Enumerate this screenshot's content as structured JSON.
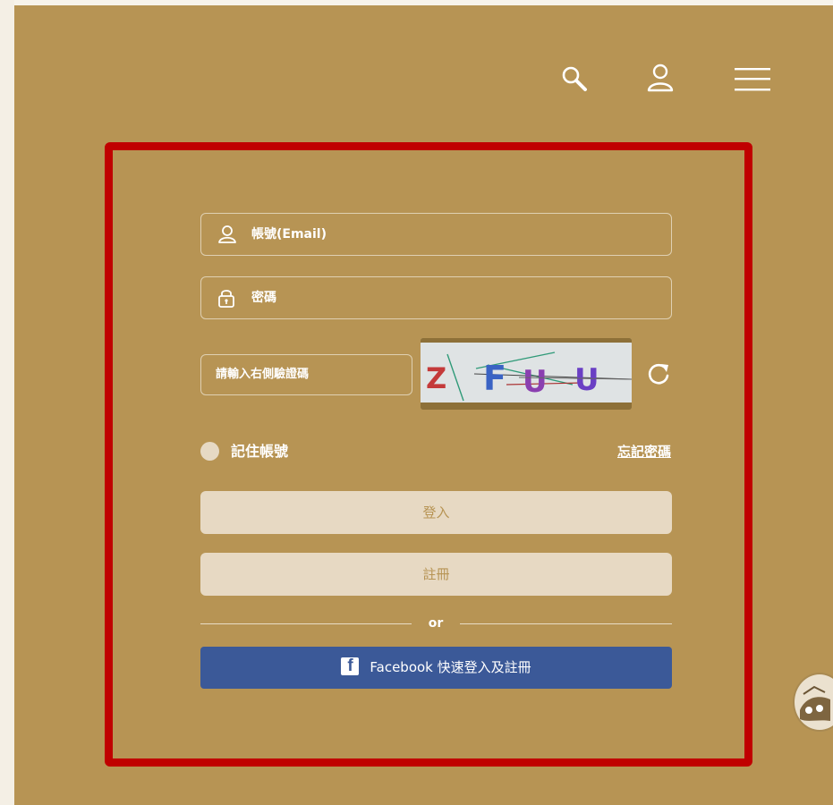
{
  "header": {
    "search_icon": "search-icon",
    "user_icon": "user-icon",
    "menu_icon": "hamburger-menu-icon"
  },
  "login_form": {
    "account_placeholder": "帳號(Email)",
    "password_placeholder": "密碼",
    "captcha_placeholder": "請輸入右側驗證碼",
    "captcha_text": "ZFUU",
    "remember_label": "記住帳號",
    "forgot_link": "忘記密碼",
    "login_button": "登入",
    "register_button": "註冊",
    "divider_text": "or",
    "facebook_button": "Facebook 快速登入及註冊"
  },
  "colors": {
    "page_background": "#b79454",
    "highlight_frame": "#c00000",
    "facebook_blue": "#3b5998",
    "button_background": "#e7d9c3"
  }
}
